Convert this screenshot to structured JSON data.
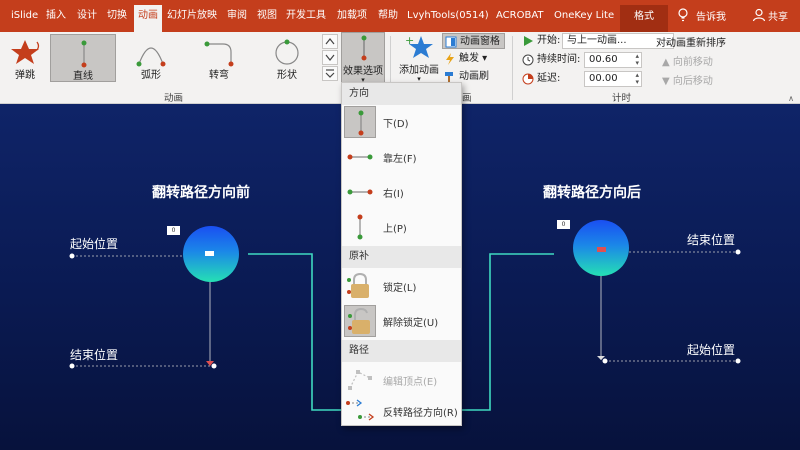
{
  "menubar": {
    "tabs": [
      "iSlide",
      "插入",
      "设计",
      "切换",
      "动画",
      "幻灯片放映",
      "审阅",
      "视图",
      "开发工具",
      "加载项",
      "帮助",
      "LvyhTools(0514)",
      "ACROBAT",
      "OneKey Lite"
    ],
    "active_tab": "动画",
    "format_tab": "格式",
    "tell_me": "告诉我",
    "share": "共享"
  },
  "ribbon": {
    "animations": [
      {
        "label": "弹跳",
        "icon": "bounce-star-icon"
      },
      {
        "label": "直线",
        "icon": "line-path-icon",
        "selected": true
      },
      {
        "label": "弧形",
        "icon": "arc-path-icon"
      },
      {
        "label": "转弯",
        "icon": "turn-path-icon"
      },
      {
        "label": "形状",
        "icon": "shape-path-icon"
      }
    ],
    "effect_options": "效果选项",
    "animation_group": "动画",
    "add_animation": "添加动画",
    "animation_pane": "动画窗格",
    "trigger": "触发",
    "animation_painter": "动画刷",
    "advanced_group_label": "画",
    "timing": {
      "start_label": "开始:",
      "start_value": "与上一动画...",
      "duration_label": "持续时间:",
      "duration_value": "00.60",
      "delay_label": "延迟:",
      "delay_value": "00.00",
      "group_label": "计时"
    },
    "reorder": {
      "title": "对动画重新排序",
      "move_earlier": "向前移动",
      "move_later": "向后移动"
    },
    "colors": {
      "menubar": "#c43e1c",
      "ribbon": "#f3f2f1",
      "selected": "#c8c6c4"
    }
  },
  "slide": {
    "left_title": "翻转路径方向前",
    "right_title": "翻转路径方向后",
    "left_start": "起始位置",
    "left_end": "结束位置",
    "right_end": "结束位置",
    "right_start": "起始位置",
    "tag_number": "0",
    "colors": {
      "background": "#0a1a52",
      "connector": "#3fd9c0"
    }
  },
  "dropdown": {
    "section_direction": "方向",
    "items_direction": [
      {
        "label": "下(D)",
        "selected": true
      },
      {
        "label": "靠左(F)"
      },
      {
        "label": "右(I)"
      },
      {
        "label": "上(P)"
      }
    ],
    "section_origin": "原补",
    "items_origin": [
      {
        "label": "锁定(L)"
      },
      {
        "label": "解除锁定(U)",
        "selected": true
      }
    ],
    "section_path": "路径",
    "items_path": [
      {
        "label": "编辑顶点(E)",
        "disabled": true
      },
      {
        "label": "反转路径方向(R)"
      }
    ]
  }
}
